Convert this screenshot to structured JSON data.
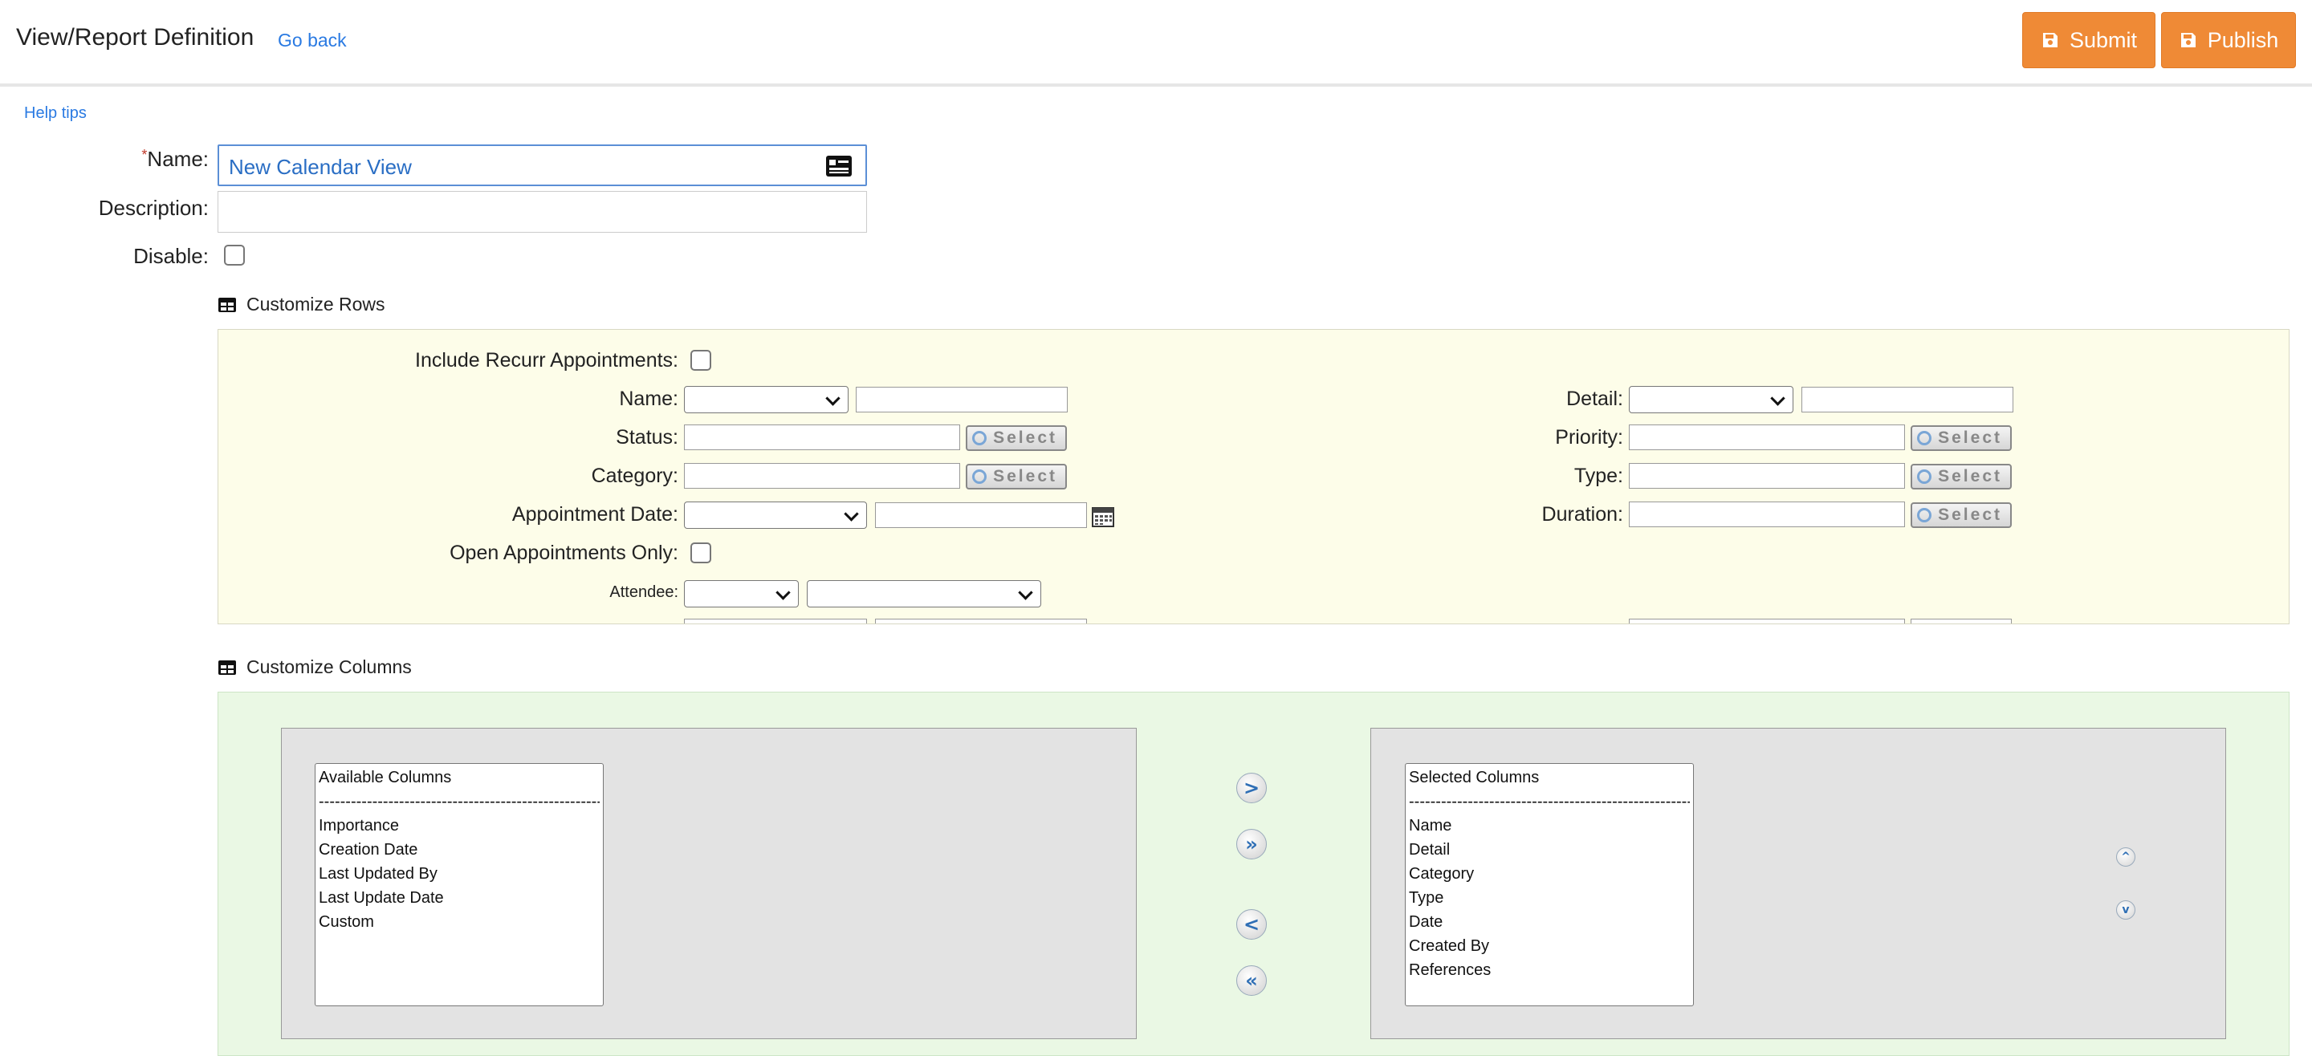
{
  "header": {
    "title": "View/Report Definition",
    "go_back": "Go back",
    "submit_label": "Submit",
    "publish_label": "Publish",
    "accent_color": "#ef8a36"
  },
  "help_tips": "Help tips",
  "form": {
    "name_label": "Name:",
    "name_required_mark": "*",
    "name_value": "New Calendar View",
    "description_label": "Description:",
    "description_value": "",
    "disable_label": "Disable:",
    "disable_checked": false
  },
  "customize_rows": {
    "title": "Customize Rows",
    "include_recurr_label": "Include Recurr Appointments:",
    "name_label": "Name:",
    "status_label": "Status:",
    "category_label": "Category:",
    "appointment_date_label": "Appointment Date:",
    "open_only_label": "Open Appointments Only:",
    "attendee_label": "Attendee:",
    "detail_label": "Detail:",
    "priority_label": "Priority:",
    "type_label": "Type:",
    "duration_label": "Duration:",
    "select_button": "Select",
    "panel_color": "#fdfde9"
  },
  "customize_columns": {
    "title": "Customize Columns",
    "available": {
      "header": "Available Columns",
      "separator": "--------------------------------------------------------",
      "items": [
        "Importance",
        "Creation Date",
        "Last Updated By",
        "Last Update Date",
        "Custom"
      ]
    },
    "selected": {
      "header": "Selected Columns",
      "separator": "--------------------------------------------------------",
      "items": [
        "Name",
        "Detail",
        "Category",
        "Type",
        "Date",
        "Created By",
        "References"
      ]
    },
    "move_right": ">",
    "move_all_right": "»",
    "move_left": "<",
    "move_all_left": "«",
    "move_up": "^",
    "move_down": "v",
    "panel_color": "#eaf8e4"
  }
}
